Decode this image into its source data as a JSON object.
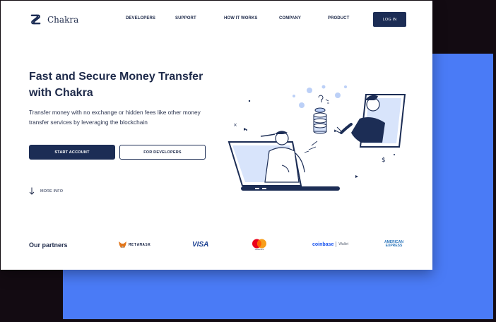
{
  "brand": {
    "name": "Chakra"
  },
  "nav": {
    "items": [
      {
        "label": "DEVELOPERS"
      },
      {
        "label": "SUPPORT"
      },
      {
        "label": "HOW IT WORKS"
      },
      {
        "label": "COMPANY"
      },
      {
        "label": "PRODUCT"
      }
    ],
    "login_label": "LOG IN"
  },
  "hero": {
    "title": "Fast and Secure Money Transfer with Chakra",
    "subtitle": "Transfer money with no exchange or hidden fees like other money transfer services by leveraging the blockchain",
    "primary_button": "START ACCOUNT",
    "secondary_button": "FOR DEVELOPERS",
    "more_info": "MORE INFO"
  },
  "partners": {
    "label": "Our partners",
    "items": [
      {
        "name": "METAMASK",
        "icon": "fox-icon"
      },
      {
        "name": "VISA"
      },
      {
        "name": "mastercard",
        "icon": "mastercard-circles-icon"
      },
      {
        "name": "coinbase",
        "suffix": "Wallet"
      },
      {
        "name_line1": "AMERICAN",
        "name_line2": "EXPRESS"
      }
    ]
  },
  "colors": {
    "primary": "#1c2d55",
    "accent_blue": "#4a7bf6",
    "background": "#130b12",
    "mastercard_red": "#eb001b",
    "mastercard_orange": "#f79e1b"
  }
}
